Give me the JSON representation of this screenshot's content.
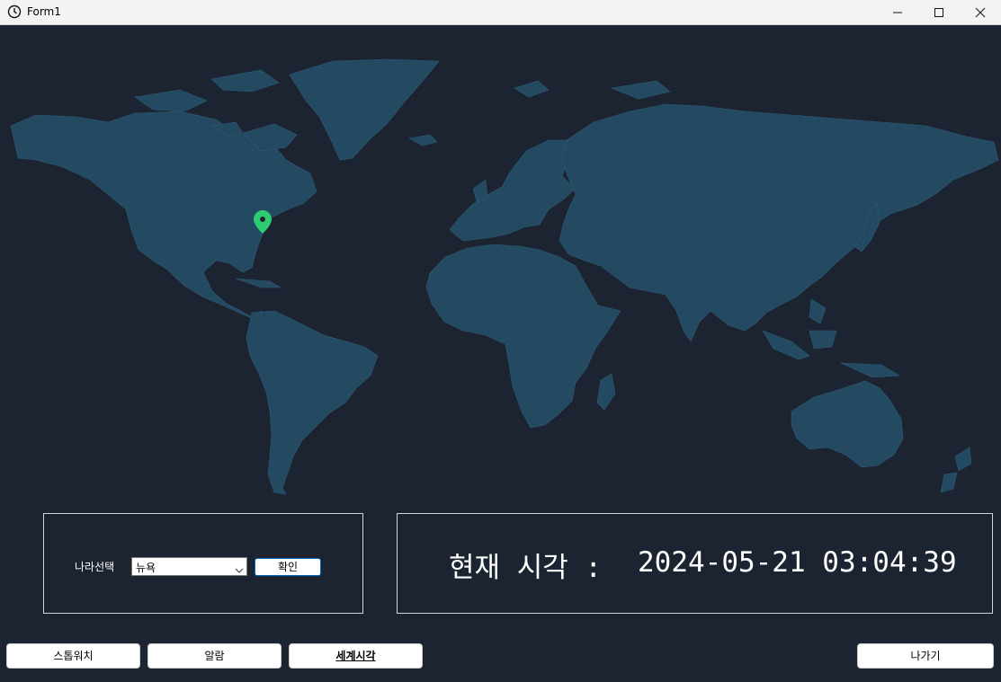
{
  "window": {
    "title": "Form1"
  },
  "map": {
    "selected_marker_color": "#2ecc71",
    "land_color": "#244a62",
    "ocean_color": "#1c2331"
  },
  "country_panel": {
    "label": "나라선택",
    "selected_country": "뉴욕",
    "confirm_label": "확인"
  },
  "time_panel": {
    "label": "현재 시각 :",
    "value": "2024-05-21 03:04:39"
  },
  "nav": {
    "stopwatch_label": "스톱워치",
    "alarm_label": "알람",
    "worldclock_label": "세계시각",
    "exit_label": "나가기"
  }
}
